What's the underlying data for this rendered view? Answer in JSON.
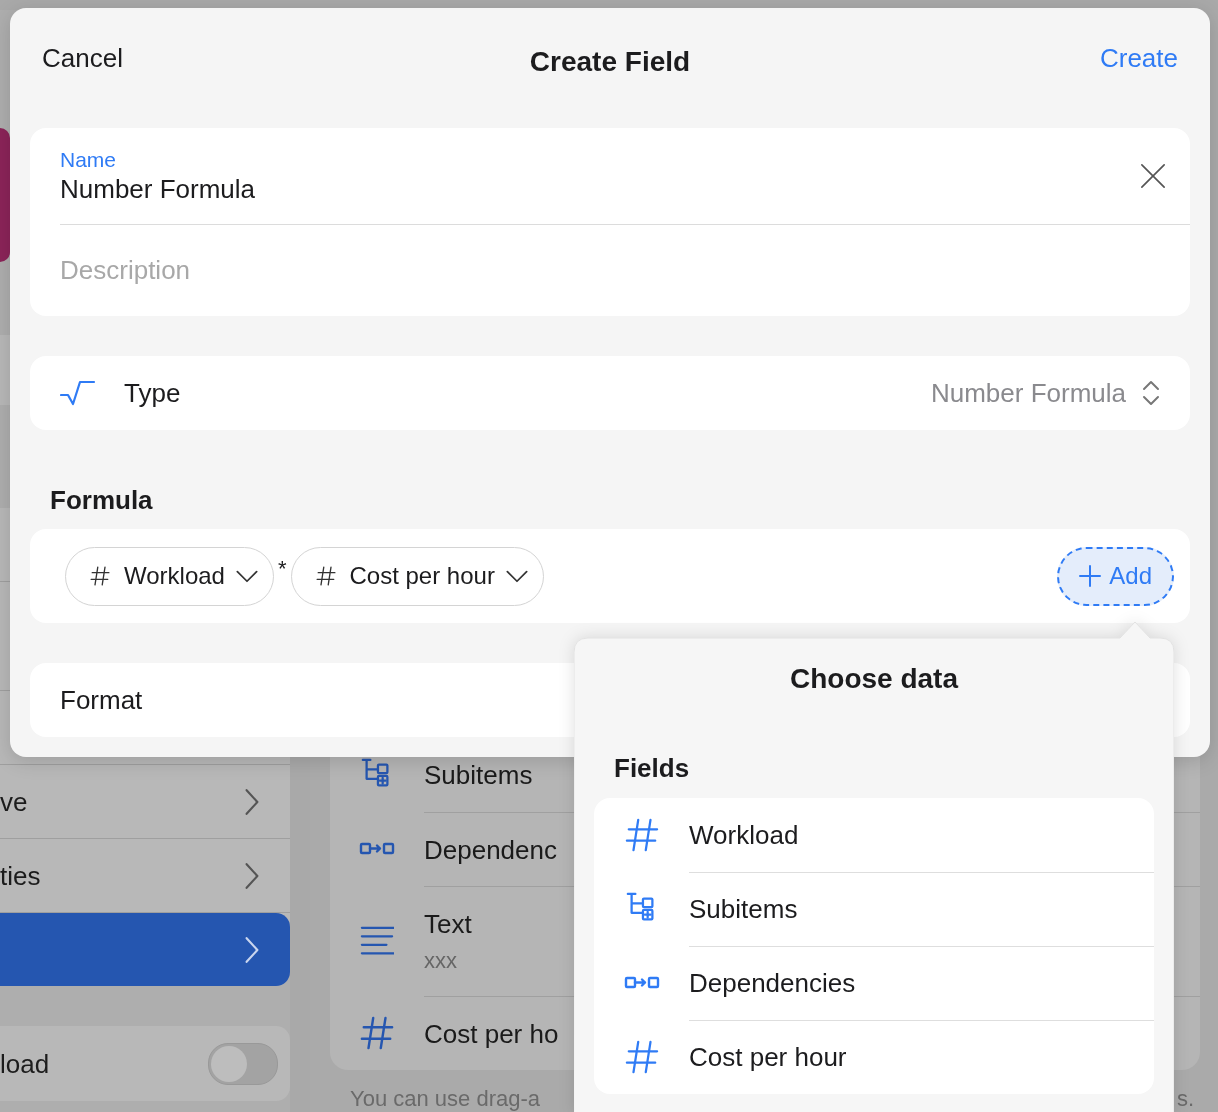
{
  "app": {
    "sidebar": {
      "items": [
        {
          "label": "ve",
          "selected": false
        },
        {
          "label": "ties",
          "selected": false
        },
        {
          "selected": true
        }
      ],
      "toggle": {
        "label": "load",
        "on": false
      }
    },
    "fields": [
      {
        "label": "Subitems",
        "kind": "subitems"
      },
      {
        "label": "Dependenc",
        "kind": "dependencies"
      },
      {
        "label": "Text",
        "subtitle": "xxx",
        "kind": "text"
      },
      {
        "label": "Cost per ho",
        "kind": "number"
      }
    ],
    "footnote": "You can use drag-a",
    "footnote_end": "s."
  },
  "modal": {
    "cancel": "Cancel",
    "title": "Create Field",
    "create": "Create",
    "name": {
      "label": "Name",
      "value": "Number Formula"
    },
    "description": {
      "placeholder": "Description"
    },
    "type": {
      "label": "Type",
      "value": "Number Formula"
    },
    "formula": {
      "heading": "Formula",
      "tokens": [
        {
          "kind": "field",
          "label": "Workload"
        },
        {
          "kind": "operator",
          "label": "*"
        },
        {
          "kind": "field",
          "label": "Cost per hour"
        }
      ],
      "add": "Add"
    },
    "format": {
      "label": "Format"
    }
  },
  "popover": {
    "title": "Choose data",
    "section": "Fields",
    "items": [
      {
        "label": "Workload",
        "kind": "number"
      },
      {
        "label": "Subitems",
        "kind": "subitems"
      },
      {
        "label": "Dependencies",
        "kind": "dependencies"
      },
      {
        "label": "Cost per hour",
        "kind": "number"
      }
    ]
  }
}
